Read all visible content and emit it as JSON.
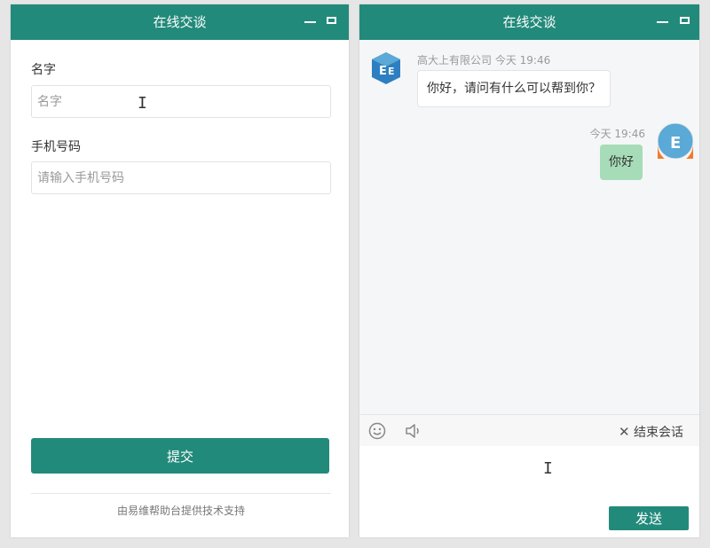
{
  "left_window": {
    "title": "在线交谈",
    "form": {
      "name_label": "名字",
      "name_placeholder": "名字",
      "phone_label": "手机号码",
      "phone_placeholder": "请输入手机号码",
      "submit_label": "提交"
    },
    "footer_text": "由易维帮助台提供技术支持"
  },
  "right_window": {
    "title": "在线交谈",
    "messages": [
      {
        "sender": "高大上有限公司",
        "time": "今天 19:46",
        "text": "你好，请问有什么可以帮到你？"
      },
      {
        "time": "今天 19:46",
        "text": "你好"
      }
    ],
    "toolbar": {
      "end_chat_label": "结束会话"
    },
    "composer": {
      "send_label": "发送"
    }
  },
  "colors": {
    "brand": "#228a7b",
    "user_bubble": "#a6dcb7",
    "avatar_orange": "#f07a2b",
    "avatar_blue": "#5aa9d6"
  },
  "icons": [
    "minimize-icon",
    "maximize-icon",
    "emoji-icon",
    "speaker-icon",
    "close-icon",
    "text-cursor-icon"
  ]
}
